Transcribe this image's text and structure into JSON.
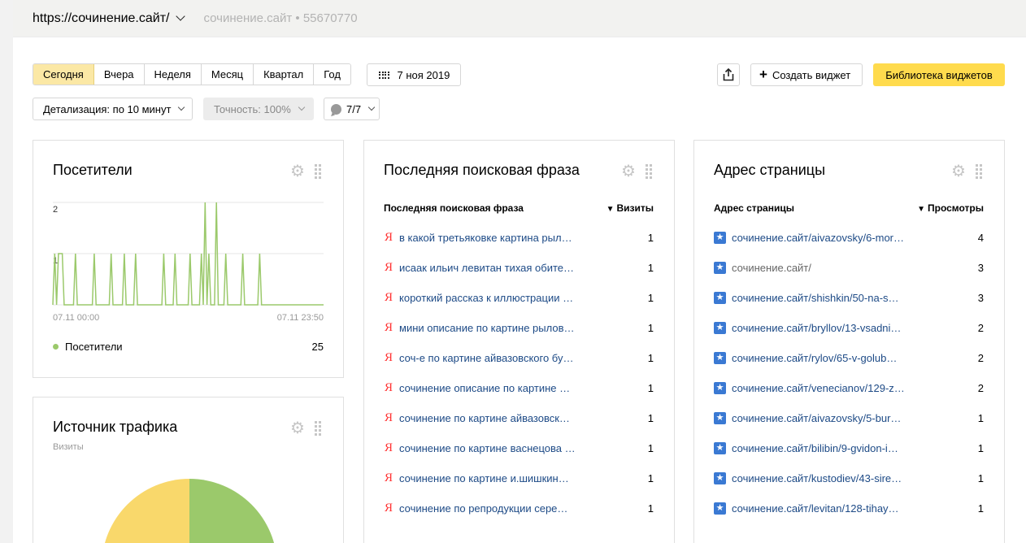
{
  "header": {
    "site_url": "https://сочинение.сайт/",
    "site_meta": "сочинение.сайт • 55670770"
  },
  "toolbar": {
    "periods": [
      "Сегодня",
      "Вчера",
      "Неделя",
      "Месяц",
      "Квартал",
      "Год"
    ],
    "active_period": "Сегодня",
    "date": "7 ноя 2019",
    "create_widget": "Создать виджет",
    "widget_library": "Библиотека виджетов",
    "detail": "Детализация: по 10 минут",
    "accuracy": "Точность: 100%",
    "segments": "7/7"
  },
  "visitors": {
    "title": "Посетители",
    "y_ticks": [
      "2",
      "1"
    ],
    "x_start": "07.11 00:00",
    "x_end": "07.11 23:50",
    "legend_label": "Посетители",
    "legend_total": "25",
    "line_color": "#9bc96b",
    "chart_data": {
      "type": "line",
      "series": [
        {
          "name": "Посетители",
          "values": [
            0,
            1,
            0,
            1,
            1,
            1,
            0,
            0,
            0,
            0,
            0,
            0,
            1,
            0,
            0,
            0,
            0,
            0,
            0,
            0,
            0,
            0,
            1,
            0,
            0,
            0,
            0,
            0,
            0,
            0,
            0,
            1,
            0,
            0,
            0,
            0,
            0,
            0,
            1,
            0,
            0,
            0,
            0,
            0,
            1,
            0,
            0,
            0,
            0,
            0,
            0,
            0,
            0,
            0,
            0,
            0,
            0,
            0,
            0,
            1,
            0,
            0,
            0,
            0,
            0,
            1,
            0,
            0,
            0,
            0,
            0,
            0,
            0,
            1,
            0,
            0,
            0,
            0,
            0,
            1,
            0,
            2,
            0,
            1,
            0,
            0,
            0,
            2,
            0,
            0,
            0,
            0,
            1,
            0,
            0,
            0,
            0,
            0,
            0,
            0,
            0,
            1,
            0,
            0,
            0,
            0,
            0,
            0,
            0,
            0,
            1,
            0,
            0,
            0,
            0,
            0,
            0,
            0,
            0,
            0,
            0,
            0,
            0,
            0,
            0,
            0,
            0,
            0,
            0,
            0,
            0,
            0,
            0,
            0,
            0,
            0,
            0,
            0,
            0,
            0,
            0,
            0,
            0,
            0,
            0
          ]
        }
      ],
      "ylim": [
        0,
        2
      ]
    }
  },
  "traffic": {
    "title": "Источник трафика",
    "subtitle": "Визиты",
    "colors": [
      "#f9d86b",
      "#9bc96b"
    ]
  },
  "search": {
    "title": "Последняя поисковая фраза",
    "col_phrase": "Последняя поисковая фраза",
    "col_visits": "Визиты",
    "rows": [
      {
        "text": "в какой третьяковке картина рыл…",
        "value": "1"
      },
      {
        "text": "исаак ильич левитан тихая обите…",
        "value": "1"
      },
      {
        "text": "короткий рассказ к иллюстрации …",
        "value": "1"
      },
      {
        "text": "мини описание по картине рылов…",
        "value": "1"
      },
      {
        "text": "соч-е по картине айвазовского бу…",
        "value": "1"
      },
      {
        "text": "сочинение описание по картине …",
        "value": "1"
      },
      {
        "text": "сочинение по картине айвазовск…",
        "value": "1"
      },
      {
        "text": "сочинение по картине васнецова …",
        "value": "1"
      },
      {
        "text": "сочинение по картине и.шишкин…",
        "value": "1"
      },
      {
        "text": "сочинение по репродукции сере…",
        "value": "1"
      }
    ]
  },
  "pages": {
    "title": "Адрес страницы",
    "col_page": "Адрес страницы",
    "col_views": "Просмотры",
    "rows": [
      {
        "text": "сочинение.сайт/aivazovsky/6-mor…",
        "value": "4"
      },
      {
        "text": "сочинение.сайт/",
        "value": "3"
      },
      {
        "text": "сочинение.сайт/shishkin/50-na-s…",
        "value": "3"
      },
      {
        "text": "сочинение.сайт/bryllov/13-vsadni…",
        "value": "2"
      },
      {
        "text": "сочинение.сайт/rylov/65-v-golub…",
        "value": "2"
      },
      {
        "text": "сочинение.сайт/venecianov/129-z…",
        "value": "2"
      },
      {
        "text": "сочинение.сайт/aivazovsky/5-bur…",
        "value": "1"
      },
      {
        "text": "сочинение.сайт/bilibin/9-gvidon-i…",
        "value": "1"
      },
      {
        "text": "сочинение.сайт/kustodiev/43-sire…",
        "value": "1"
      },
      {
        "text": "сочинение.сайт/levitan/128-tihay…",
        "value": "1"
      }
    ]
  }
}
